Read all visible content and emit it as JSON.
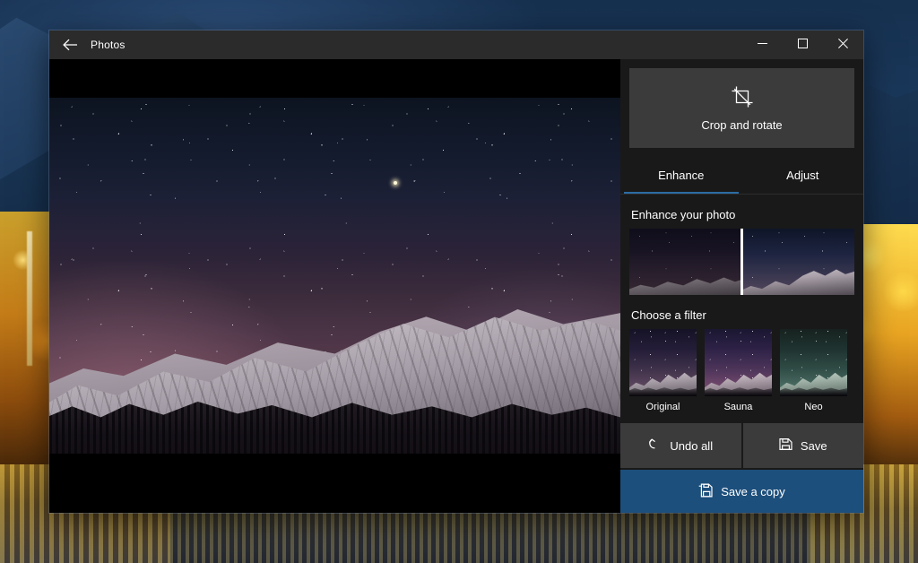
{
  "theme": {
    "accent": "#1d4f7c",
    "tab_underline": "#2b6ca3",
    "panel_bg": "#191919",
    "card_bg": "#3b3b3b",
    "titlebar_bg": "#2b2b2b"
  },
  "window": {
    "title": "Photos",
    "back_icon": "back-arrow-icon",
    "caption": {
      "minimize": "minimize-icon",
      "maximize": "maximize-icon",
      "close": "close-icon"
    }
  },
  "viewer": {
    "photo_alt": "Starry night sky over snowy mountain range",
    "letterbox": "black"
  },
  "panel": {
    "crop": {
      "label": "Crop and rotate",
      "icon": "crop-icon"
    },
    "tabs": [
      {
        "label": "Enhance",
        "active": true
      },
      {
        "label": "Adjust",
        "active": false
      }
    ],
    "enhance": {
      "title": "Enhance your photo",
      "slider_position_percent": 50
    },
    "filters": {
      "title": "Choose a filter",
      "items": [
        {
          "label": "Original",
          "selected": true
        },
        {
          "label": "Sauna",
          "selected": false
        },
        {
          "label": "Neo",
          "selected": false
        }
      ]
    },
    "actions": {
      "undo_all": {
        "label": "Undo all",
        "icon": "undo-icon"
      },
      "save": {
        "label": "Save",
        "icon": "save-disk-icon"
      },
      "save_a_copy": {
        "label": "Save a copy",
        "icon": "save-copy-disk-icon"
      }
    }
  }
}
